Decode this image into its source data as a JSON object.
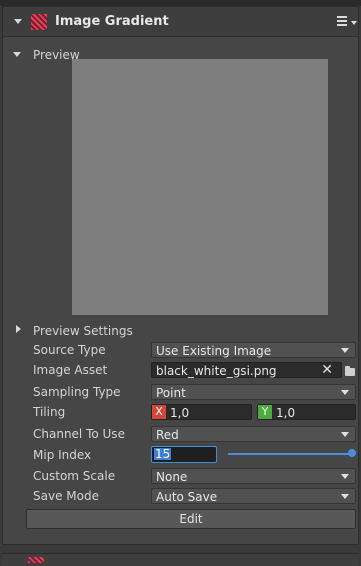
{
  "header": {
    "title": "Image Gradient",
    "icon": "image-gradient-icon"
  },
  "preview": {
    "label": "Preview",
    "color": "#7f7f7f"
  },
  "preview_settings": {
    "label": "Preview Settings"
  },
  "properties": {
    "source_type": {
      "label": "Source Type",
      "value": "Use Existing Image"
    },
    "image_asset": {
      "label": "Image Asset",
      "value": "black_white_gsi.png",
      "clear": "✕"
    },
    "sampling_type": {
      "label": "Sampling Type",
      "value": "Point"
    },
    "tiling": {
      "label": "Tiling",
      "x_axis": "X",
      "x_value": "1,0",
      "y_axis": "Y",
      "y_value": "1,0"
    },
    "channel": {
      "label": "Channel To Use",
      "value": "Red"
    },
    "mip_index": {
      "label": "Mip Index",
      "value": "15"
    },
    "custom_scale": {
      "label": "Custom Scale",
      "value": "None"
    },
    "save_mode": {
      "label": "Save Mode",
      "value": "Auto Save"
    }
  },
  "edit_button": {
    "label": "Edit"
  },
  "colors": {
    "accent": "#4d8ed8",
    "x_axis": "#d4463a",
    "y_axis": "#4caa3f"
  }
}
